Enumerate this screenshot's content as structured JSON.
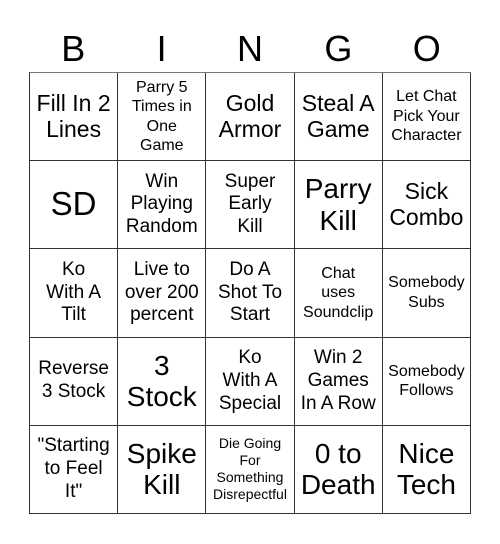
{
  "header": {
    "letters": [
      "B",
      "I",
      "N",
      "G",
      "O"
    ]
  },
  "cells": [
    [
      {
        "text": "Fill In 2\nLines",
        "size": "lg"
      },
      {
        "text": "Parry 5\nTimes in\nOne\nGame",
        "size": "sm"
      },
      {
        "text": "Gold\nArmor",
        "size": "lg"
      },
      {
        "text": "Steal A\nGame",
        "size": "lg"
      },
      {
        "text": "Let Chat\nPick Your\nCharacter",
        "size": "sm"
      }
    ],
    [
      {
        "text": "SD",
        "size": "xxl"
      },
      {
        "text": "Win\nPlaying\nRandom",
        "size": "md"
      },
      {
        "text": "Super\nEarly\nKill",
        "size": "md"
      },
      {
        "text": "Parry\nKill",
        "size": "xl"
      },
      {
        "text": "Sick\nCombo",
        "size": "lg"
      }
    ],
    [
      {
        "text": "Ko\nWith A\nTilt",
        "size": "md"
      },
      {
        "text": "Live to\nover 200\npercent",
        "size": "md"
      },
      {
        "text": "Do A\nShot To\nStart",
        "size": "md"
      },
      {
        "text": "Chat\nuses\nSoundclip",
        "size": "sm"
      },
      {
        "text": "Somebody\nSubs",
        "size": "sm"
      }
    ],
    [
      {
        "text": "Reverse\n3 Stock",
        "size": "md"
      },
      {
        "text": "3\nStock",
        "size": "xl"
      },
      {
        "text": "Ko\nWith A\nSpecial",
        "size": "md"
      },
      {
        "text": "Win 2\nGames\nIn A Row",
        "size": "md"
      },
      {
        "text": "Somebody\nFollows",
        "size": "sm"
      }
    ],
    [
      {
        "text": "\"Starting\nto Feel\nIt\"",
        "size": "md"
      },
      {
        "text": "Spike\nKill",
        "size": "xl"
      },
      {
        "text": "Die Going\nFor\nSomething\nDisrepectful",
        "size": "xs"
      },
      {
        "text": "0 to\nDeath",
        "size": "xl"
      },
      {
        "text": "Nice\nTech",
        "size": "xl"
      }
    ]
  ]
}
